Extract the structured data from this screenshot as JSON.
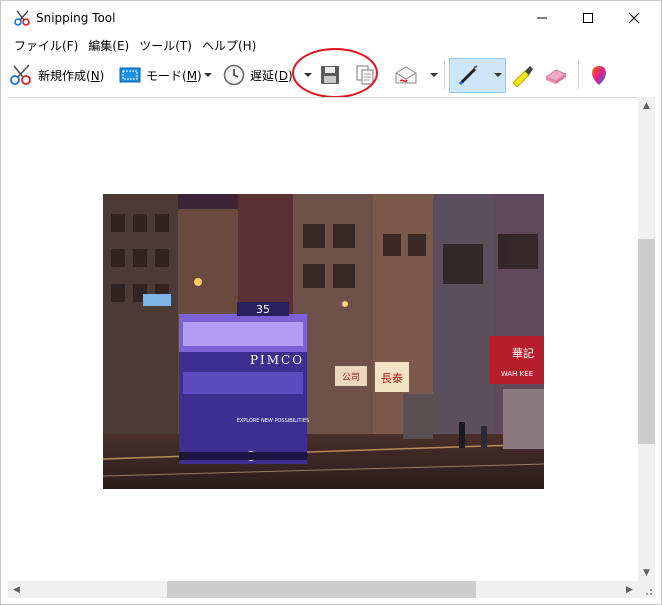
{
  "window": {
    "title": "Snipping Tool",
    "controls": {
      "minimize": "–",
      "maximize": "☐",
      "close": "✕"
    }
  },
  "menu": [
    {
      "label": "ファイル(F)"
    },
    {
      "label": "編集(E)"
    },
    {
      "label": "ツール(T)"
    },
    {
      "label": "ヘルプ(H)"
    }
  ],
  "toolbar": {
    "new_label": "新規作成(",
    "new_key": "N",
    "new_close": ")",
    "mode_label": "モード(",
    "mode_key": "M",
    "mode_close": ")",
    "delay_label": "遅延(",
    "delay_key": "D",
    "delay_close": ")"
  },
  "image": {
    "tram_number": "35",
    "tram_ad": "PIMCO",
    "tram_slogan": "EXPLORE NEW POSSIBILITIES",
    "sign_1": "長泰",
    "sign_2": "華記",
    "sign_3": "WAH KEE",
    "sign_4": "公司"
  },
  "colors": {
    "accent_selected": "#cde5f7",
    "annotation_circle": "#e3121d",
    "scrollbar_thumb": "#cdcdcd"
  }
}
